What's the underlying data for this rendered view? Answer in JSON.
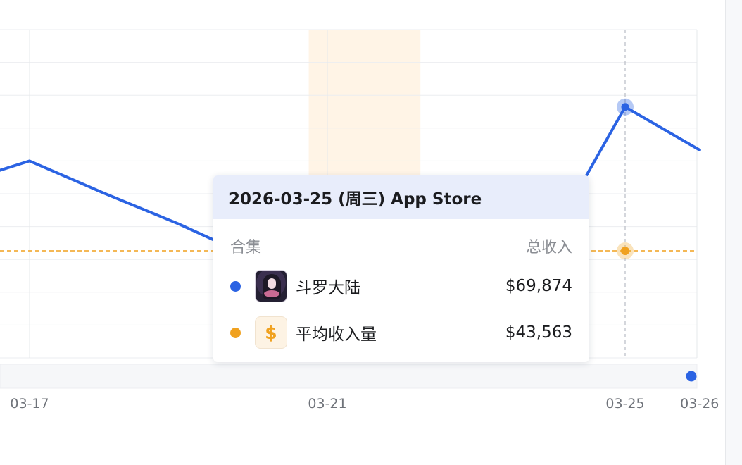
{
  "chart_data": {
    "type": "line",
    "x_visible_range": [
      "2026-03-16",
      "2026-03-26"
    ],
    "x_tick_labels": [
      {
        "date": "2026-03-17",
        "label": "03-17"
      },
      {
        "date": "2026-03-21",
        "label": "03-21"
      },
      {
        "date": "2026-03-25",
        "label": "03-25"
      },
      {
        "date": "2026-03-26",
        "label": "03-26"
      }
    ],
    "y_range": [
      24000,
      84000
    ],
    "grid": true,
    "series": [
      {
        "name": "斗罗大陆",
        "color": "#2b63e3",
        "points": [
          {
            "date": "2026-03-16",
            "value": 55700
          },
          {
            "date": "2026-03-17",
            "value": 60000
          },
          {
            "date": "2026-03-18",
            "value": 54100
          },
          {
            "date": "2026-03-19",
            "value": 48500
          },
          {
            "date": "2026-03-20",
            "value": 42300
          },
          {
            "date": "2026-03-21",
            "value": 40000
          },
          {
            "date": "2026-03-22",
            "value": 50300
          },
          {
            "date": "2026-03-23",
            "value": 51500
          },
          {
            "date": "2026-03-24",
            "value": 45800
          },
          {
            "date": "2026-03-25",
            "value": 69874
          },
          {
            "date": "2026-03-26",
            "value": 62000
          }
        ]
      }
    ],
    "reference_line": {
      "name": "平均收入量",
      "value": 43563,
      "color": "#f0a11f"
    },
    "highlight_band": {
      "from": "2026-03-20.75",
      "to": "2026-03-22.25",
      "color": "#fff4e6"
    },
    "hover_date": "2026-03-25",
    "zoom_handle_color": "#2b63e3"
  },
  "tooltip": {
    "title": "2026-03-25 (周三) App Store",
    "col_left": "合集",
    "col_right": "总收入",
    "rows": [
      {
        "name": "斗罗大陆",
        "value": "$69,874",
        "dot_color": "#2b63e3",
        "icon": "game-character-icon"
      },
      {
        "name": "平均收入量",
        "value": "$43,563",
        "dot_color": "#f0a11f",
        "icon": "dollar-icon",
        "icon_glyph": "$"
      }
    ]
  }
}
